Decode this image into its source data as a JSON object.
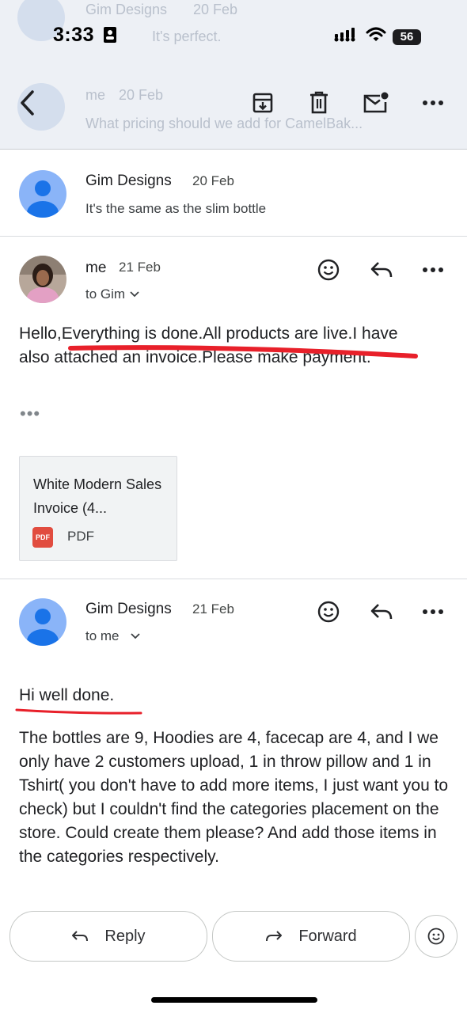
{
  "status_bar": {
    "time": "3:33",
    "battery": "56"
  },
  "background_threads": [
    {
      "sender": "Gim Designs",
      "date": "20 Feb",
      "snippet": "It's perfect."
    },
    {
      "sender": "me",
      "date": "20 Feb",
      "snippet": "What pricing should we add for CamelBak..."
    }
  ],
  "toolbar": {
    "back_icon": "chevron-left-icon",
    "archive_icon": "archive-icon",
    "delete_icon": "trash-icon",
    "unread_icon": "mail-unread-icon",
    "more_icon": "more-horizontal-icon"
  },
  "collapsed_message": {
    "sender": "Gim Designs",
    "date": "20 Feb",
    "snippet": "It's the same as the slim bottle"
  },
  "message_me": {
    "sender": "me",
    "date": "21 Feb",
    "to": "to Gim",
    "body": "Hello,Everything is done.All products are live.I have also attached an invoice.Please make payment.",
    "trimmed": "•••",
    "attachment": {
      "name": "White Modern Sales Invoice (4...",
      "type": "PDF",
      "badge": "PDF"
    }
  },
  "message_gim": {
    "sender": "Gim Designs",
    "date": "21 Feb",
    "to": "to me",
    "greeting": "Hi well done.",
    "body": "The bottles are 9, Hoodies are 4, facecap are 4, and I we only have 2 customers upload, 1 in throw pillow and 1 in Tshirt( you don't have to add more items, I just want you to check) but I couldn't find the categories placement on the store.  Could create them please? And add those items in the categories respectively."
  },
  "actions": {
    "reply": "Reply",
    "forward": "Forward"
  },
  "colors": {
    "annotation_red": "#e8202a",
    "avatar_blue": "#8ab4f8",
    "avatar_figure": "#1a73e8"
  }
}
